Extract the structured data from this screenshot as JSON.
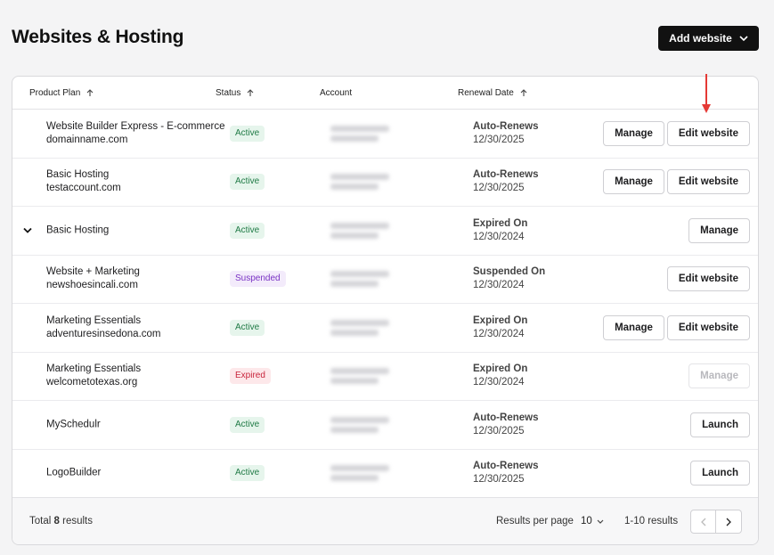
{
  "page": {
    "title": "Websites & Hosting",
    "add_button": "Add website"
  },
  "table": {
    "headers": {
      "plan": "Product Plan",
      "status": "Status",
      "account": "Account",
      "renewal": "Renewal Date"
    },
    "rows": [
      {
        "plan_line1": "Website Builder Express - E-commerce",
        "plan_line2": "domainname.com",
        "status": "Active",
        "renew_label": "Auto-Renews",
        "renew_date": "12/30/2025",
        "actions": [
          "Manage",
          "Edit website"
        ]
      },
      {
        "plan_line1": "Basic Hosting",
        "plan_line2": "testaccount.com",
        "status": "Active",
        "renew_label": "Auto-Renews",
        "renew_date": "12/30/2025",
        "actions": [
          "Manage",
          "Edit website"
        ]
      },
      {
        "plan_line1": "Basic Hosting",
        "plan_line2": "",
        "status": "Active",
        "renew_label": "Expired On",
        "renew_date": "12/30/2024",
        "actions": [
          "Manage"
        ]
      },
      {
        "plan_line1": "Website + Marketing",
        "plan_line2": "newshoesincali.com",
        "status": "Suspended",
        "renew_label": "Suspended On",
        "renew_date": "12/30/2024",
        "actions": [
          "Edit website"
        ]
      },
      {
        "plan_line1": "Marketing Essentials",
        "plan_line2": "adventuresinsedona.com",
        "status": "Active",
        "renew_label": "Expired On",
        "renew_date": "12/30/2024",
        "actions": [
          "Manage",
          "Edit website"
        ]
      },
      {
        "plan_line1": "Marketing Essentials",
        "plan_line2": "welcometotexas.org",
        "status": "Expired",
        "renew_label": "Expired On",
        "renew_date": "12/30/2024",
        "actions": [
          "Manage"
        ]
      },
      {
        "plan_line1": "MySchedulr",
        "plan_line2": "",
        "status": "Active",
        "renew_label": "Auto-Renews",
        "renew_date": "12/30/2025",
        "actions": [
          "Launch"
        ]
      },
      {
        "plan_line1": "LogoBuilder",
        "plan_line2": "",
        "status": "Active",
        "renew_label": "Auto-Renews",
        "renew_date": "12/30/2025",
        "actions": [
          "Launch"
        ]
      }
    ]
  },
  "footer": {
    "total_prefix": "Total",
    "total_count": "8",
    "total_suffix": "results",
    "rpp_label": "Results per page",
    "rpp_value": "10",
    "range": "1-10 results"
  },
  "colors": {
    "annotation_arrow": "#e53935",
    "primary_button": "#111111"
  }
}
